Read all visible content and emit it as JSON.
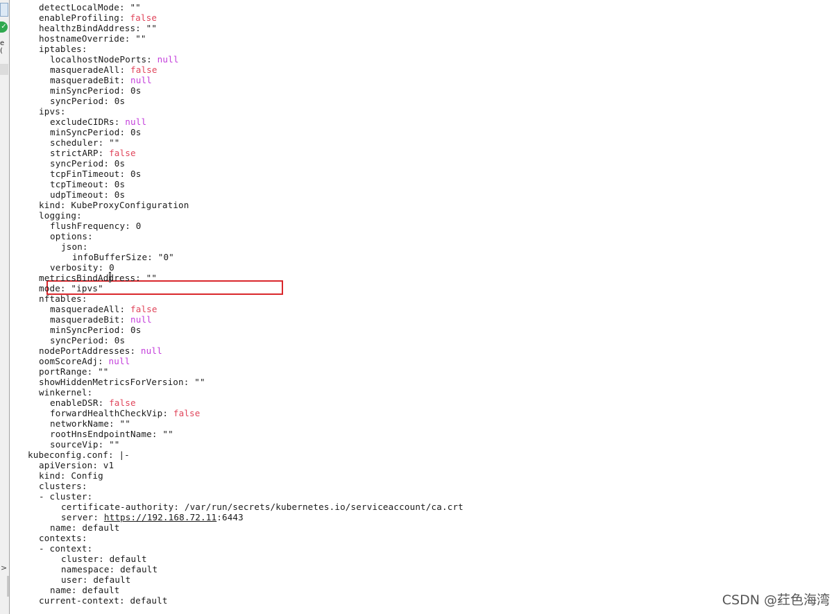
{
  "sidebar": {
    "clipped_label": "e (",
    "check_icon": "checkmark-icon",
    "expand_arrow": ">"
  },
  "terminal": {
    "lines": [
      {
        "indent": 2,
        "key": "detectLocalMode: ",
        "value": "\"\"",
        "type": "str"
      },
      {
        "indent": 2,
        "key": "enableProfiling: ",
        "value": "false",
        "type": "false"
      },
      {
        "indent": 2,
        "key": "healthzBindAddress: ",
        "value": "\"\"",
        "type": "str"
      },
      {
        "indent": 2,
        "key": "hostnameOverride: ",
        "value": "\"\"",
        "type": "str"
      },
      {
        "indent": 2,
        "key": "iptables:",
        "value": "",
        "type": "str"
      },
      {
        "indent": 4,
        "key": "localhostNodePorts: ",
        "value": "null",
        "type": "null"
      },
      {
        "indent": 4,
        "key": "masqueradeAll: ",
        "value": "false",
        "type": "false"
      },
      {
        "indent": 4,
        "key": "masqueradeBit: ",
        "value": "null",
        "type": "null"
      },
      {
        "indent": 4,
        "key": "minSyncPeriod: ",
        "value": "0s",
        "type": "str"
      },
      {
        "indent": 4,
        "key": "syncPeriod: ",
        "value": "0s",
        "type": "str"
      },
      {
        "indent": 2,
        "key": "ipvs:",
        "value": "",
        "type": "str"
      },
      {
        "indent": 4,
        "key": "excludeCIDRs: ",
        "value": "null",
        "type": "null"
      },
      {
        "indent": 4,
        "key": "minSyncPeriod: ",
        "value": "0s",
        "type": "str"
      },
      {
        "indent": 4,
        "key": "scheduler: ",
        "value": "\"\"",
        "type": "str"
      },
      {
        "indent": 4,
        "key": "strictARP: ",
        "value": "false",
        "type": "false"
      },
      {
        "indent": 4,
        "key": "syncPeriod: ",
        "value": "0s",
        "type": "str"
      },
      {
        "indent": 4,
        "key": "tcpFinTimeout: ",
        "value": "0s",
        "type": "str"
      },
      {
        "indent": 4,
        "key": "tcpTimeout: ",
        "value": "0s",
        "type": "str"
      },
      {
        "indent": 4,
        "key": "udpTimeout: ",
        "value": "0s",
        "type": "str"
      },
      {
        "indent": 2,
        "key": "kind: ",
        "value": "KubeProxyConfiguration",
        "type": "str"
      },
      {
        "indent": 2,
        "key": "logging:",
        "value": "",
        "type": "str"
      },
      {
        "indent": 4,
        "key": "flushFrequency: ",
        "value": "0",
        "type": "str"
      },
      {
        "indent": 4,
        "key": "options:",
        "value": "",
        "type": "str"
      },
      {
        "indent": 6,
        "key": "json:",
        "value": "",
        "type": "str"
      },
      {
        "indent": 8,
        "key": "infoBufferSize: ",
        "value": "\"0\"",
        "type": "str"
      },
      {
        "indent": 4,
        "key": "verbosity: ",
        "value": "0",
        "type": "str"
      },
      {
        "indent": 2,
        "key": "metricsBindAddress: ",
        "value": "\"\"",
        "type": "str"
      },
      {
        "indent": 2,
        "key": "mode: ",
        "value": "\"ipvs\"",
        "type": "str"
      },
      {
        "indent": 2,
        "key": "nftables:",
        "value": "",
        "type": "str"
      },
      {
        "indent": 4,
        "key": "masqueradeAll: ",
        "value": "false",
        "type": "false"
      },
      {
        "indent": 4,
        "key": "masqueradeBit: ",
        "value": "null",
        "type": "null"
      },
      {
        "indent": 4,
        "key": "minSyncPeriod: ",
        "value": "0s",
        "type": "str"
      },
      {
        "indent": 4,
        "key": "syncPeriod: ",
        "value": "0s",
        "type": "str"
      },
      {
        "indent": 2,
        "key": "nodePortAddresses: ",
        "value": "null",
        "type": "null"
      },
      {
        "indent": 2,
        "key": "oomScoreAdj: ",
        "value": "null",
        "type": "null"
      },
      {
        "indent": 2,
        "key": "portRange: ",
        "value": "\"\"",
        "type": "str"
      },
      {
        "indent": 2,
        "key": "showHiddenMetricsForVersion: ",
        "value": "\"\"",
        "type": "str"
      },
      {
        "indent": 2,
        "key": "winkernel:",
        "value": "",
        "type": "str"
      },
      {
        "indent": 4,
        "key": "enableDSR: ",
        "value": "false",
        "type": "false"
      },
      {
        "indent": 4,
        "key": "forwardHealthCheckVip: ",
        "value": "false",
        "type": "false"
      },
      {
        "indent": 4,
        "key": "networkName: ",
        "value": "\"\"",
        "type": "str"
      },
      {
        "indent": 4,
        "key": "rootHnsEndpointName: ",
        "value": "\"\"",
        "type": "str"
      },
      {
        "indent": 4,
        "key": "sourceVip: ",
        "value": "\"\"",
        "type": "str"
      },
      {
        "indent": 0,
        "key": "kubeconfig.conf: ",
        "value": "|-",
        "type": "str"
      },
      {
        "indent": 2,
        "key": "apiVersion: ",
        "value": "v1",
        "type": "str"
      },
      {
        "indent": 2,
        "key": "kind: ",
        "value": "Config",
        "type": "str"
      },
      {
        "indent": 2,
        "key": "clusters:",
        "value": "",
        "type": "str"
      },
      {
        "indent": 2,
        "key": "- cluster:",
        "value": "",
        "type": "str"
      },
      {
        "indent": 6,
        "key": "certificate-authority: ",
        "value": "/var/run/secrets/kubernetes.io/serviceaccount/ca.crt",
        "type": "str"
      },
      {
        "indent": 6,
        "key": "server: ",
        "value": "https://192.168.72.11",
        "type": "url",
        "suffix": ":6443"
      },
      {
        "indent": 4,
        "key": "name: ",
        "value": "default",
        "type": "str"
      },
      {
        "indent": 2,
        "key": "contexts:",
        "value": "",
        "type": "str"
      },
      {
        "indent": 2,
        "key": "- context:",
        "value": "",
        "type": "str"
      },
      {
        "indent": 6,
        "key": "cluster: ",
        "value": "default",
        "type": "str"
      },
      {
        "indent": 6,
        "key": "namespace: ",
        "value": "default",
        "type": "str"
      },
      {
        "indent": 6,
        "key": "user: ",
        "value": "default",
        "type": "str"
      },
      {
        "indent": 4,
        "key": "name: ",
        "value": "default",
        "type": "str"
      },
      {
        "indent": 2,
        "key": "current-context: ",
        "value": "default",
        "type": "str"
      }
    ]
  },
  "colors": {
    "false_value": "#e0445a",
    "null_value": "#c33ddb",
    "highlight_border": "#d9262b"
  },
  "watermark": {
    "text": "CSDN @荭色海湾"
  }
}
